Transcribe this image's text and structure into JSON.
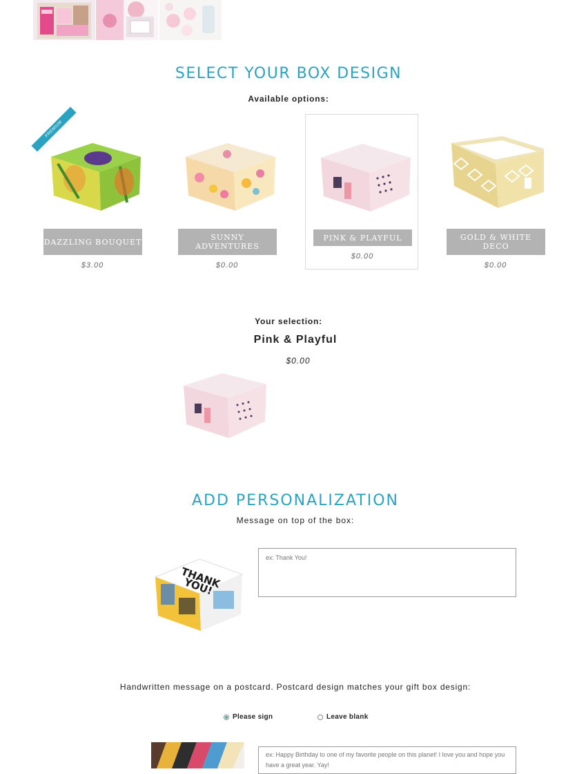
{
  "gallery": {
    "thumbnails": [
      "gift-box-photo",
      "treats-photo",
      "cookies-photo"
    ]
  },
  "box_design": {
    "heading": "SELECT YOUR BOX DESIGN",
    "available_label": "Available options:",
    "options": [
      {
        "name": "DAZZLING BOUQUET",
        "price": "$3.00",
        "badge": "PREMIUM",
        "selected": false
      },
      {
        "name": "SUNNY ADVENTURES",
        "price": "$0.00",
        "selected": false
      },
      {
        "name": "PINK & PLAYFUL",
        "price": "$0.00",
        "selected": true
      },
      {
        "name": "GOLD & WHITE DECO",
        "price": "$0.00",
        "selected": false
      }
    ]
  },
  "selection": {
    "label": "Your selection:",
    "name": "Pink & Playful",
    "price": "$0.00"
  },
  "personalization": {
    "heading": "ADD PERSONALIZATION",
    "message_label": "Message on top of the box:",
    "message_placeholder": "ex: Thank You!",
    "postcard_label": "Handwritten message on a postcard. Postcard design matches your gift box design:",
    "radio_sign": "Please sign",
    "radio_blank": "Leave blank",
    "radio_selected": "Please sign",
    "postcard_placeholder": "ex: Happy Birthday to one of my favorite people on this planet! I love you and hope you have a great year. Yay!"
  },
  "colors": {
    "accent": "#2aa3c0",
    "label_bg": "#b3b3b3",
    "radio_on": "#3aa89a"
  }
}
